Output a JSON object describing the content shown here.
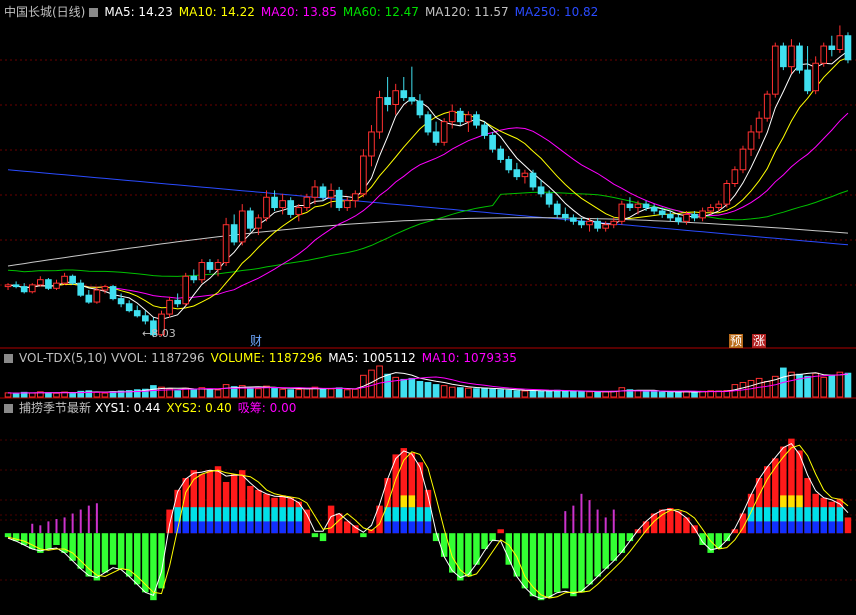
{
  "main_panel": {
    "title": "中国长城(日线)",
    "indicators": [
      {
        "label": "MA5: 14.23",
        "color": "#ffffff"
      },
      {
        "label": "MA10: 14.22",
        "color": "#ffff00"
      },
      {
        "label": "MA20: 13.85",
        "color": "#ff00ff"
      },
      {
        "label": "MA60: 12.47",
        "color": "#00e000"
      },
      {
        "label": "MA120: 11.57",
        "color": "#c0c0c0"
      },
      {
        "label": "MA250: 10.82",
        "color": "#2a4bff"
      }
    ],
    "low_label": "←8.03",
    "badges": [
      {
        "text": "财",
        "color": "#6fa8ff",
        "bg": "#000000"
      },
      {
        "text": "预",
        "color": "#ffffff",
        "bg": "#b86a1a"
      },
      {
        "text": "涨",
        "color": "#ffffff",
        "bg": "#b02020"
      }
    ]
  },
  "volume_panel": {
    "title": "VOL-TDX(5,10)",
    "indicators": [
      {
        "label": "VVOL: 1187296",
        "color": "#c0c0c0"
      },
      {
        "label": "VOLUME: 1187296",
        "color": "#ffff00"
      },
      {
        "label": "MA5: 1005112",
        "color": "#ffffff"
      },
      {
        "label": "MA10: 1079335",
        "color": "#ff00ff"
      }
    ]
  },
  "osc_panel": {
    "title": "捕捞季节最新",
    "indicators": [
      {
        "label": "XYS1: 0.44",
        "color": "#ffffff"
      },
      {
        "label": "XYS2: 0.40",
        "color": "#ffff00"
      },
      {
        "label": "吸筹: 0.00",
        "color": "#ff00ff"
      }
    ]
  },
  "chart_data": [
    {
      "type": "candlestick",
      "title": "中国长城(日线)",
      "ylim": [
        7.8,
        17.2
      ],
      "ma_latest": {
        "MA5": 14.23,
        "MA10": 14.22,
        "MA20": 13.85,
        "MA60": 12.47,
        "MA120": 11.57,
        "MA250": 10.82
      },
      "annotations": [
        "←8.03"
      ],
      "candles": [
        [
          9.5,
          9.6,
          9.4,
          9.55
        ],
        [
          9.55,
          9.65,
          9.45,
          9.5
        ],
        [
          9.5,
          9.6,
          9.3,
          9.35
        ],
        [
          9.35,
          9.6,
          9.3,
          9.55
        ],
        [
          9.55,
          9.8,
          9.5,
          9.7
        ],
        [
          9.7,
          9.75,
          9.4,
          9.45
        ],
        [
          9.45,
          9.7,
          9.4,
          9.6
        ],
        [
          9.6,
          9.9,
          9.55,
          9.8
        ],
        [
          9.8,
          9.85,
          9.55,
          9.6
        ],
        [
          9.6,
          9.7,
          9.2,
          9.25
        ],
        [
          9.25,
          9.4,
          9.0,
          9.05
        ],
        [
          9.05,
          9.5,
          9.0,
          9.4
        ],
        [
          9.4,
          9.55,
          9.3,
          9.5
        ],
        [
          9.5,
          9.55,
          9.1,
          9.15
        ],
        [
          9.15,
          9.3,
          8.9,
          9.0
        ],
        [
          9.0,
          9.1,
          8.75,
          8.8
        ],
        [
          8.8,
          8.95,
          8.6,
          8.65
        ],
        [
          8.65,
          8.8,
          8.4,
          8.5
        ],
        [
          8.5,
          8.6,
          8.03,
          8.1
        ],
        [
          8.1,
          8.8,
          8.05,
          8.7
        ],
        [
          8.7,
          9.2,
          8.6,
          9.1
        ],
        [
          9.1,
          9.3,
          8.9,
          9.0
        ],
        [
          9.0,
          9.9,
          8.95,
          9.8
        ],
        [
          9.8,
          10.0,
          9.6,
          9.7
        ],
        [
          9.7,
          10.3,
          9.6,
          10.2
        ],
        [
          10.2,
          10.3,
          9.9,
          10.0
        ],
        [
          10.0,
          10.3,
          9.8,
          10.2
        ],
        [
          10.2,
          11.5,
          10.1,
          11.3
        ],
        [
          11.3,
          11.6,
          10.7,
          10.8
        ],
        [
          10.8,
          11.9,
          10.7,
          11.7
        ],
        [
          11.7,
          11.8,
          11.1,
          11.2
        ],
        [
          11.2,
          11.6,
          11.0,
          11.5
        ],
        [
          11.5,
          12.3,
          11.4,
          12.1
        ],
        [
          12.1,
          12.3,
          11.7,
          11.8
        ],
        [
          11.8,
          12.2,
          11.6,
          12.0
        ],
        [
          12.0,
          12.1,
          11.5,
          11.6
        ],
        [
          11.6,
          11.9,
          11.4,
          11.8
        ],
        [
          11.8,
          12.2,
          11.7,
          12.1
        ],
        [
          12.1,
          12.6,
          11.9,
          12.4
        ],
        [
          12.4,
          12.5,
          12.0,
          12.1
        ],
        [
          12.1,
          12.5,
          11.8,
          12.3
        ],
        [
          12.3,
          12.4,
          11.7,
          11.8
        ],
        [
          11.8,
          12.1,
          11.7,
          12.0
        ],
        [
          12.0,
          12.3,
          11.8,
          12.2
        ],
        [
          12.2,
          13.5,
          12.1,
          13.3
        ],
        [
          13.3,
          14.2,
          13.0,
          14.0
        ],
        [
          14.0,
          15.2,
          13.8,
          15.0
        ],
        [
          15.0,
          15.6,
          14.6,
          14.8
        ],
        [
          14.8,
          15.4,
          14.5,
          15.2
        ],
        [
          15.2,
          15.6,
          14.9,
          15.0
        ],
        [
          15.0,
          15.9,
          14.8,
          14.9
        ],
        [
          14.9,
          15.1,
          14.4,
          14.5
        ],
        [
          14.5,
          14.6,
          13.9,
          14.0
        ],
        [
          14.0,
          14.3,
          13.6,
          13.7
        ],
        [
          13.7,
          14.4,
          13.6,
          14.3
        ],
        [
          14.3,
          14.8,
          14.1,
          14.6
        ],
        [
          14.6,
          14.7,
          14.2,
          14.3
        ],
        [
          14.3,
          14.6,
          14.0,
          14.5
        ],
        [
          14.5,
          14.6,
          14.1,
          14.2
        ],
        [
          14.2,
          14.3,
          13.8,
          13.9
        ],
        [
          13.9,
          14.0,
          13.4,
          13.5
        ],
        [
          13.5,
          13.6,
          13.1,
          13.2
        ],
        [
          13.2,
          13.3,
          12.8,
          12.9
        ],
        [
          12.9,
          13.1,
          12.6,
          12.7
        ],
        [
          12.7,
          12.9,
          12.5,
          12.8
        ],
        [
          12.8,
          12.9,
          12.3,
          12.4
        ],
        [
          12.4,
          12.6,
          12.1,
          12.2
        ],
        [
          12.2,
          12.3,
          11.8,
          11.9
        ],
        [
          11.9,
          12.0,
          11.5,
          11.6
        ],
        [
          11.6,
          11.8,
          11.4,
          11.5
        ],
        [
          11.5,
          11.6,
          11.3,
          11.4
        ],
        [
          11.4,
          11.5,
          11.2,
          11.3
        ],
        [
          11.3,
          11.5,
          11.1,
          11.4
        ],
        [
          11.4,
          11.5,
          11.1,
          11.2
        ],
        [
          11.2,
          11.4,
          11.1,
          11.3
        ],
        [
          11.3,
          11.5,
          11.2,
          11.4
        ],
        [
          11.4,
          12.0,
          11.3,
          11.9
        ],
        [
          11.9,
          12.1,
          11.7,
          11.8
        ],
        [
          11.8,
          12.0,
          11.6,
          11.9
        ],
        [
          11.9,
          12.0,
          11.7,
          11.8
        ],
        [
          11.8,
          11.9,
          11.6,
          11.7
        ],
        [
          11.7,
          11.8,
          11.5,
          11.6
        ],
        [
          11.6,
          11.7,
          11.4,
          11.5
        ],
        [
          11.5,
          11.6,
          11.3,
          11.4
        ],
        [
          11.4,
          11.7,
          11.3,
          11.6
        ],
        [
          11.6,
          11.7,
          11.4,
          11.5
        ],
        [
          11.5,
          11.8,
          11.4,
          11.7
        ],
        [
          11.7,
          11.9,
          11.6,
          11.8
        ],
        [
          11.8,
          12.0,
          11.7,
          11.9
        ],
        [
          11.9,
          12.6,
          11.8,
          12.5
        ],
        [
          12.5,
          13.0,
          12.4,
          12.9
        ],
        [
          12.9,
          13.6,
          12.8,
          13.5
        ],
        [
          13.5,
          14.2,
          13.3,
          14.0
        ],
        [
          14.0,
          14.6,
          13.8,
          14.4
        ],
        [
          14.4,
          15.2,
          14.3,
          15.1
        ],
        [
          15.1,
          16.6,
          15.0,
          16.5
        ],
        [
          16.5,
          16.6,
          15.8,
          15.9
        ],
        [
          15.9,
          16.7,
          15.7,
          16.5
        ],
        [
          16.5,
          16.6,
          15.7,
          15.8
        ],
        [
          15.8,
          16.5,
          15.1,
          15.2
        ],
        [
          15.2,
          16.2,
          15.1,
          16.0
        ],
        [
          16.0,
          16.6,
          15.9,
          16.5
        ],
        [
          16.5,
          16.8,
          16.2,
          16.4
        ],
        [
          16.4,
          17.1,
          16.3,
          16.8
        ],
        [
          16.8,
          16.9,
          16.0,
          16.1
        ]
      ]
    },
    {
      "type": "bar",
      "title": "VOL-TDX(5,10)",
      "latest": {
        "VVOL": 1187296,
        "VOLUME": 1187296,
        "MA5": 1005112,
        "MA10": 1079335
      },
      "volumes": [
        40,
        35,
        45,
        38,
        50,
        42,
        36,
        48,
        40,
        55,
        60,
        45,
        38,
        52,
        58,
        62,
        70,
        75,
        110,
        95,
        80,
        60,
        85,
        70,
        90,
        75,
        68,
        120,
        100,
        110,
        85,
        80,
        105,
        90,
        75,
        70,
        72,
        85,
        95,
        80,
        78,
        88,
        70,
        75,
        210,
        260,
        300,
        220,
        190,
        170,
        180,
        150,
        140,
        120,
        110,
        95,
        90,
        85,
        80,
        85,
        75,
        70,
        65,
        60,
        58,
        62,
        55,
        60,
        65,
        58,
        55,
        52,
        50,
        48,
        50,
        55,
        90,
        70,
        60,
        55,
        50,
        48,
        46,
        50,
        52,
        48,
        55,
        60,
        58,
        62,
        120,
        140,
        160,
        180,
        150,
        200,
        280,
        240,
        220,
        200,
        230,
        190,
        210,
        240,
        230
      ]
    },
    {
      "type": "bar",
      "title": "捕捞季节最新",
      "latest": {
        "XYS1": 0.44,
        "XYS2": 0.4,
        "吸筹": 0.0
      },
      "ylim": [
        -1.0,
        1.5
      ],
      "values": [
        -0.05,
        -0.1,
        -0.15,
        -0.2,
        -0.25,
        -0.2,
        -0.15,
        -0.25,
        -0.35,
        -0.45,
        -0.55,
        -0.6,
        -0.5,
        -0.4,
        -0.45,
        -0.55,
        -0.65,
        -0.75,
        -0.85,
        -0.7,
        0.3,
        0.55,
        0.7,
        0.8,
        0.75,
        0.8,
        0.85,
        0.65,
        0.75,
        0.8,
        0.6,
        0.55,
        0.5,
        0.45,
        0.48,
        0.45,
        0.4,
        0.3,
        -0.05,
        -0.1,
        0.35,
        0.25,
        0.15,
        0.1,
        -0.05,
        0.05,
        0.35,
        0.7,
        1.0,
        1.08,
        1.02,
        0.9,
        0.55,
        -0.1,
        -0.3,
        -0.5,
        -0.6,
        -0.55,
        -0.4,
        -0.2,
        -0.1,
        0.05,
        -0.4,
        -0.55,
        -0.7,
        -0.8,
        -0.85,
        -0.82,
        -0.75,
        -0.7,
        -0.8,
        -0.75,
        -0.65,
        -0.55,
        -0.45,
        -0.35,
        -0.25,
        -0.1,
        0.05,
        0.15,
        0.25,
        0.3,
        0.32,
        0.28,
        0.2,
        0.1,
        -0.15,
        -0.25,
        -0.2,
        -0.1,
        0.05,
        0.25,
        0.5,
        0.7,
        0.85,
        0.95,
        1.1,
        1.2,
        1.05,
        0.7,
        0.5,
        0.45,
        0.4,
        0.44,
        0.2
      ],
      "accumulate": [
        0,
        0,
        0,
        0.12,
        0.1,
        0.15,
        0.18,
        0.2,
        0.25,
        0.3,
        0.35,
        0.38,
        0,
        0,
        0,
        0,
        0,
        0,
        0,
        0,
        0,
        0,
        0,
        0,
        0,
        0,
        0,
        0,
        0,
        0,
        0,
        0,
        0,
        0,
        0,
        0,
        0,
        0,
        0,
        0,
        0,
        0,
        0,
        0,
        0,
        0,
        0,
        0,
        0,
        0,
        0,
        0,
        0,
        0,
        0,
        0,
        0,
        0,
        0,
        0,
        0,
        0,
        0,
        0,
        0,
        0,
        0,
        0,
        0,
        0.28,
        0.35,
        0.5,
        0.42,
        0.3,
        0.2,
        0.3,
        0,
        0,
        0,
        0,
        0,
        0,
        0,
        0,
        0,
        0,
        0,
        0,
        0,
        0,
        0,
        0,
        0,
        0,
        0,
        0,
        0,
        0,
        0,
        0,
        0,
        0,
        0,
        0,
        0
      ]
    }
  ]
}
